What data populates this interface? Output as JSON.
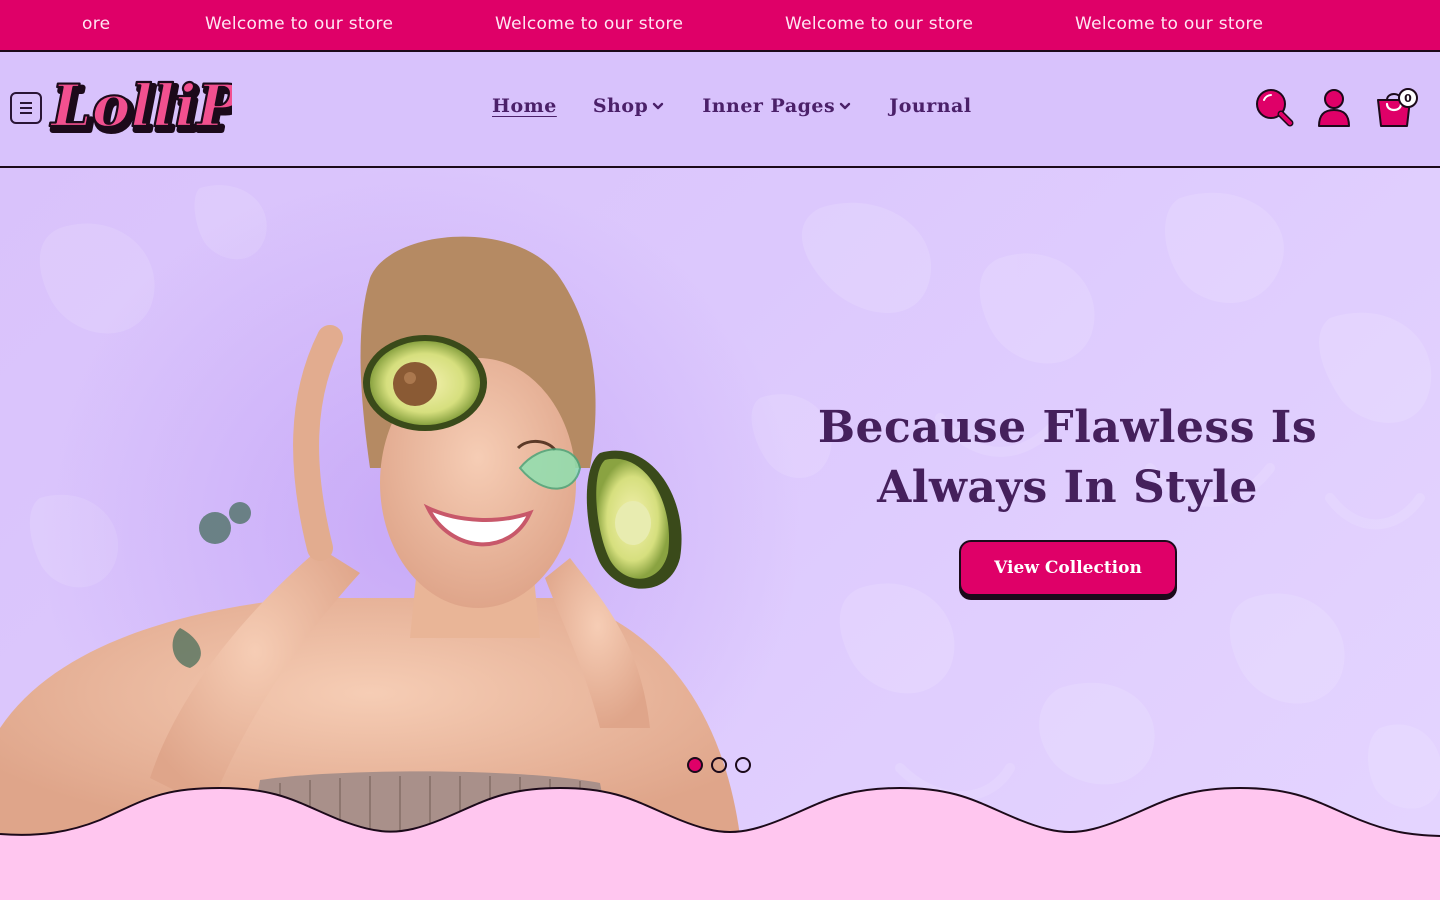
{
  "announcement": {
    "items": [
      "ore",
      "Welcome to our store",
      "Welcome to our store",
      "Welcome to our store",
      "Welcome to our store"
    ]
  },
  "header": {
    "logo_text": "LolliPop",
    "nav": [
      {
        "label": "Home",
        "has_dropdown": false,
        "active": true
      },
      {
        "label": "Shop",
        "has_dropdown": true,
        "active": false
      },
      {
        "label": "Inner Pages",
        "has_dropdown": true,
        "active": false
      },
      {
        "label": "Journal",
        "has_dropdown": false,
        "active": false
      }
    ],
    "icons": [
      "menu-icon",
      "search-icon",
      "account-icon",
      "cart-icon",
      "chevron-down-icon"
    ],
    "cart_count": "0"
  },
  "hero": {
    "title": "Because Flawless Is Always In Style",
    "cta_label": "View Collection",
    "slides_total": 3,
    "active_slide": 1
  },
  "colors": {
    "accent": "#df0068",
    "header_bg": "#d8c2fc",
    "hero_bg": "#dcc8fd",
    "footer_band": "#ffc6ef",
    "title_text": "#45205c",
    "nav_text": "#4b2069"
  }
}
